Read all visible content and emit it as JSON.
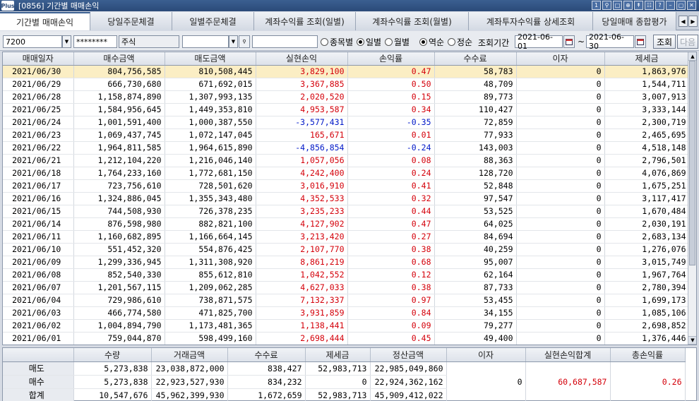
{
  "window": {
    "logo": "Plus",
    "title": "[0856] 기간별 매매손익"
  },
  "tabs": [
    {
      "label": "기간별 매매손익",
      "active": true
    },
    {
      "label": "당일주문체결",
      "active": false
    },
    {
      "label": "일별주문체결",
      "active": false
    },
    {
      "label": "계좌수익률 조회(일별)",
      "active": false
    },
    {
      "label": "계좌수익률 조회(월별)",
      "active": false
    },
    {
      "label": "계좌투자수익률 상세조회",
      "active": false
    },
    {
      "label": "당일매매 종합평가",
      "active": false
    }
  ],
  "filter": {
    "account": "7200",
    "password": "********",
    "account_type": "주식",
    "stock_code": "",
    "stock_name": "",
    "radio_by_stock": "종목별",
    "radio_daily": "일별",
    "radio_monthly": "월별",
    "radio_desc": "역순",
    "radio_asc": "정순",
    "period_label": "조회기간",
    "start_date": "2021-06-01",
    "tilde": "~",
    "end_date": "2021-06-30",
    "query_button": "조회",
    "next_button": "다음"
  },
  "grid": {
    "columns": [
      "매매일자",
      "매수금액",
      "매도금액",
      "실현손익",
      "손익률",
      "수수료",
      "이자",
      "제세금"
    ],
    "rows": [
      {
        "date": "2021/06/30",
        "buy": "804,756,585",
        "sell": "810,508,445",
        "pnl": "3,829,100",
        "rate": "0.47",
        "fee": "58,783",
        "interest": "0",
        "tax": "1,863,976",
        "sign": "pos"
      },
      {
        "date": "2021/06/29",
        "buy": "666,730,680",
        "sell": "671,692,015",
        "pnl": "3,367,885",
        "rate": "0.50",
        "fee": "48,709",
        "interest": "0",
        "tax": "1,544,711",
        "sign": "pos"
      },
      {
        "date": "2021/06/28",
        "buy": "1,158,874,890",
        "sell": "1,307,993,135",
        "pnl": "2,020,520",
        "rate": "0.15",
        "fee": "89,773",
        "interest": "0",
        "tax": "3,007,913",
        "sign": "pos"
      },
      {
        "date": "2021/06/25",
        "buy": "1,584,956,645",
        "sell": "1,449,353,810",
        "pnl": "4,953,587",
        "rate": "0.34",
        "fee": "110,427",
        "interest": "0",
        "tax": "3,333,144",
        "sign": "pos"
      },
      {
        "date": "2021/06/24",
        "buy": "1,001,591,400",
        "sell": "1,000,387,550",
        "pnl": "-3,577,431",
        "rate": "-0.35",
        "fee": "72,859",
        "interest": "0",
        "tax": "2,300,719",
        "sign": "neg"
      },
      {
        "date": "2021/06/23",
        "buy": "1,069,437,745",
        "sell": "1,072,147,045",
        "pnl": "165,671",
        "rate": "0.01",
        "fee": "77,933",
        "interest": "0",
        "tax": "2,465,695",
        "sign": "pos"
      },
      {
        "date": "2021/06/22",
        "buy": "1,964,811,585",
        "sell": "1,964,615,890",
        "pnl": "-4,856,854",
        "rate": "-0.24",
        "fee": "143,003",
        "interest": "0",
        "tax": "4,518,148",
        "sign": "neg"
      },
      {
        "date": "2021/06/21",
        "buy": "1,212,104,220",
        "sell": "1,216,046,140",
        "pnl": "1,057,056",
        "rate": "0.08",
        "fee": "88,363",
        "interest": "0",
        "tax": "2,796,501",
        "sign": "pos"
      },
      {
        "date": "2021/06/18",
        "buy": "1,764,233,160",
        "sell": "1,772,681,150",
        "pnl": "4,242,400",
        "rate": "0.24",
        "fee": "128,720",
        "interest": "0",
        "tax": "4,076,869",
        "sign": "pos"
      },
      {
        "date": "2021/06/17",
        "buy": "723,756,610",
        "sell": "728,501,620",
        "pnl": "3,016,910",
        "rate": "0.41",
        "fee": "52,848",
        "interest": "0",
        "tax": "1,675,251",
        "sign": "pos"
      },
      {
        "date": "2021/06/16",
        "buy": "1,324,886,045",
        "sell": "1,355,343,480",
        "pnl": "4,352,533",
        "rate": "0.32",
        "fee": "97,547",
        "interest": "0",
        "tax": "3,117,417",
        "sign": "pos"
      },
      {
        "date": "2021/06/15",
        "buy": "744,508,930",
        "sell": "726,378,235",
        "pnl": "3,235,233",
        "rate": "0.44",
        "fee": "53,525",
        "interest": "0",
        "tax": "1,670,484",
        "sign": "pos"
      },
      {
        "date": "2021/06/14",
        "buy": "876,598,980",
        "sell": "882,821,100",
        "pnl": "4,127,902",
        "rate": "0.47",
        "fee": "64,025",
        "interest": "0",
        "tax": "2,030,191",
        "sign": "pos"
      },
      {
        "date": "2021/06/11",
        "buy": "1,160,682,895",
        "sell": "1,166,664,145",
        "pnl": "3,213,420",
        "rate": "0.27",
        "fee": "84,694",
        "interest": "0",
        "tax": "2,683,134",
        "sign": "pos"
      },
      {
        "date": "2021/06/10",
        "buy": "551,452,320",
        "sell": "554,876,425",
        "pnl": "2,107,770",
        "rate": "0.38",
        "fee": "40,259",
        "interest": "0",
        "tax": "1,276,076",
        "sign": "pos"
      },
      {
        "date": "2021/06/09",
        "buy": "1,299,336,945",
        "sell": "1,311,308,920",
        "pnl": "8,861,219",
        "rate": "0.68",
        "fee": "95,007",
        "interest": "0",
        "tax": "3,015,749",
        "sign": "pos"
      },
      {
        "date": "2021/06/08",
        "buy": "852,540,330",
        "sell": "855,612,810",
        "pnl": "1,042,552",
        "rate": "0.12",
        "fee": "62,164",
        "interest": "0",
        "tax": "1,967,764",
        "sign": "pos"
      },
      {
        "date": "2021/06/07",
        "buy": "1,201,567,115",
        "sell": "1,209,062,285",
        "pnl": "4,627,033",
        "rate": "0.38",
        "fee": "87,733",
        "interest": "0",
        "tax": "2,780,394",
        "sign": "pos"
      },
      {
        "date": "2021/06/04",
        "buy": "729,986,610",
        "sell": "738,871,575",
        "pnl": "7,132,337",
        "rate": "0.97",
        "fee": "53,455",
        "interest": "0",
        "tax": "1,699,173",
        "sign": "pos"
      },
      {
        "date": "2021/06/03",
        "buy": "466,774,580",
        "sell": "471,825,700",
        "pnl": "3,931,859",
        "rate": "0.84",
        "fee": "34,155",
        "interest": "0",
        "tax": "1,085,106",
        "sign": "pos"
      },
      {
        "date": "2021/06/02",
        "buy": "1,004,894,790",
        "sell": "1,173,481,365",
        "pnl": "1,138,441",
        "rate": "0.09",
        "fee": "79,277",
        "interest": "0",
        "tax": "2,698,852",
        "sign": "pos"
      },
      {
        "date": "2021/06/01",
        "buy": "759,044,870",
        "sell": "598,499,160",
        "pnl": "2,698,444",
        "rate": "0.45",
        "fee": "49,400",
        "interest": "0",
        "tax": "1,376,446",
        "sign": "pos"
      }
    ]
  },
  "summary": {
    "columns": [
      "",
      "수량",
      "거래금액",
      "수수료",
      "제세금",
      "정산금액",
      "이자",
      "실현손익합계",
      "총손익률"
    ],
    "rows": [
      {
        "label": "매도",
        "qty": "5,273,838",
        "amount": "23,038,872,000",
        "fee": "838,427",
        "tax": "52,983,713",
        "settle": "22,985,049,860"
      },
      {
        "label": "매수",
        "qty": "5,273,838",
        "amount": "22,923,527,930",
        "fee": "834,232",
        "tax": "0",
        "settle": "22,924,362,162"
      },
      {
        "label": "합계",
        "qty": "10,547,676",
        "amount": "45,962,399,930",
        "fee": "1,672,659",
        "tax": "52,983,713",
        "settle": "45,909,412,022"
      }
    ],
    "interest": "0",
    "realized_total": "60,687,587",
    "total_rate": "0.26"
  },
  "colors": {
    "positive": "#d4000a",
    "negative": "#0018c8",
    "selected_row": "#fbeec4"
  }
}
